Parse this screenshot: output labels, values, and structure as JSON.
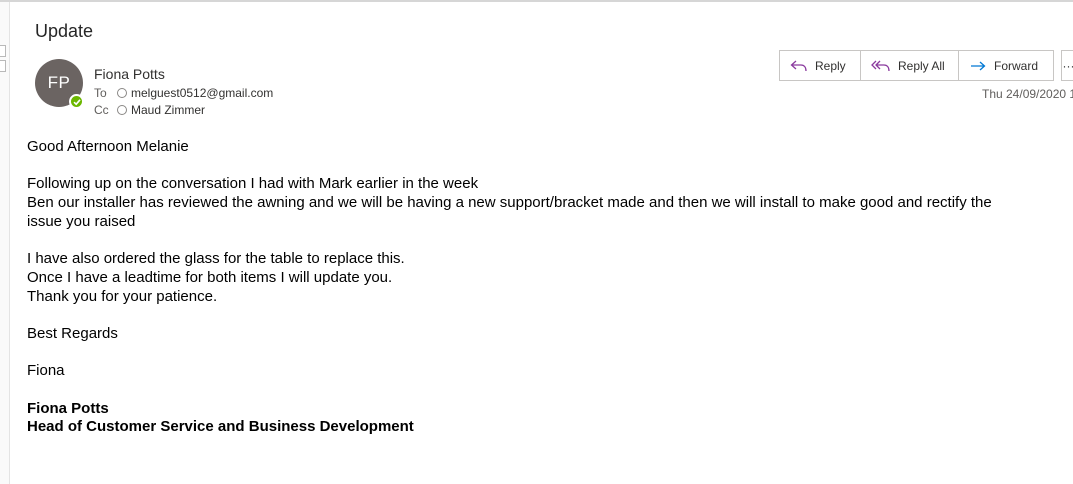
{
  "email": {
    "subject": "Update",
    "sender": {
      "initials": "FP",
      "name": "Fiona Potts",
      "status_color": "#6bb700"
    },
    "to": {
      "label": "To",
      "value": "melguest0512@gmail.com"
    },
    "cc": {
      "label": "Cc",
      "value": "Maud Zimmer"
    },
    "date": "Thu 24/09/2020 1",
    "actions": {
      "reply": "Reply",
      "reply_all": "Reply All",
      "forward": "Forward",
      "more": "···"
    },
    "body": {
      "greeting": "Good Afternoon Melanie",
      "line1": "Following up on the conversation I had with Mark earlier in the week",
      "line2": "Ben our installer has reviewed the awning and we will be having a new support/bracket made and then we will install to make good and rectify the",
      "line3": "issue you raised",
      "line4": "I have also ordered the glass for the table to replace this.",
      "line5": "Once I have a leadtime for both items I will update you.",
      "line6": "Thank you for your patience.",
      "closing": "Best Regards",
      "sign_first": "Fiona",
      "sign_name": "Fiona Potts",
      "sign_title": "Head of Customer Service and Business Development"
    }
  },
  "colors": {
    "reply_icon": "#8a3a9e",
    "forward_icon": "#0078d4",
    "avatar_bg": "#6b6462"
  }
}
